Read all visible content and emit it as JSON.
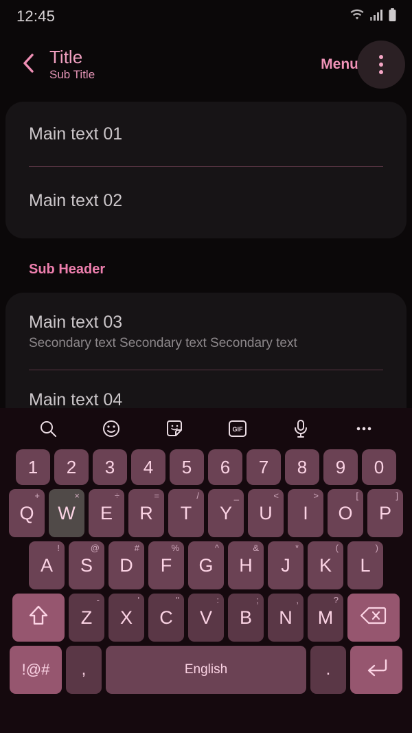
{
  "status_bar": {
    "time": "12:45",
    "icons": [
      "wifi-icon",
      "signal-icon",
      "battery-icon"
    ]
  },
  "app_bar": {
    "back_icon": "chevron-left-icon",
    "title": "Title",
    "subtitle": "Sub Title",
    "menu_label": "Menu",
    "overflow_icon": "more-vertical-icon"
  },
  "colors": {
    "accent_pink": "#f0a0c0",
    "subheader_pink": "#ee7fae",
    "card_bg": "#171416",
    "divider": "#5a3544",
    "key_bg": "#6b4254",
    "key_accent": "#96566f",
    "key_pressed": "#504a48",
    "keyboard_bg": "#15090e",
    "page_bg": "#0b0809"
  },
  "content": {
    "card_one": [
      {
        "main": "Main text 01",
        "secondary": ""
      },
      {
        "main": "Main text 02",
        "secondary": ""
      }
    ],
    "sub_header": "Sub Header",
    "card_two": [
      {
        "main": "Main text 03",
        "secondary": "Secondary text Secondary text Secondary text"
      },
      {
        "main": "Main text 04",
        "secondary": ""
      }
    ]
  },
  "keyboard": {
    "toolbar": [
      {
        "name": "search-icon",
        "label": ""
      },
      {
        "name": "emoji-icon",
        "label": ""
      },
      {
        "name": "sticker-icon",
        "label": ""
      },
      {
        "name": "gif-icon",
        "label": "GIF"
      },
      {
        "name": "microphone-icon",
        "label": ""
      },
      {
        "name": "more-horizontal-icon",
        "label": ""
      }
    ],
    "row_numbers": [
      {
        "key": "1",
        "alt": ""
      },
      {
        "key": "2",
        "alt": ""
      },
      {
        "key": "3",
        "alt": ""
      },
      {
        "key": "4",
        "alt": ""
      },
      {
        "key": "5",
        "alt": ""
      },
      {
        "key": "6",
        "alt": ""
      },
      {
        "key": "7",
        "alt": ""
      },
      {
        "key": "8",
        "alt": ""
      },
      {
        "key": "9",
        "alt": ""
      },
      {
        "key": "0",
        "alt": ""
      }
    ],
    "row_top": [
      {
        "key": "Q",
        "alt": "+",
        "pressed": false
      },
      {
        "key": "W",
        "alt": "×",
        "pressed": true
      },
      {
        "key": "E",
        "alt": "÷",
        "pressed": false
      },
      {
        "key": "R",
        "alt": "=",
        "pressed": false
      },
      {
        "key": "T",
        "alt": "/",
        "pressed": false
      },
      {
        "key": "Y",
        "alt": "_",
        "pressed": false
      },
      {
        "key": "U",
        "alt": "<",
        "pressed": false
      },
      {
        "key": "I",
        "alt": ">",
        "pressed": false
      },
      {
        "key": "O",
        "alt": "[",
        "pressed": false
      },
      {
        "key": "P",
        "alt": "]",
        "pressed": false
      }
    ],
    "row_home": [
      {
        "key": "A",
        "alt": "!"
      },
      {
        "key": "S",
        "alt": "@"
      },
      {
        "key": "D",
        "alt": "#"
      },
      {
        "key": "F",
        "alt": "%"
      },
      {
        "key": "G",
        "alt": "^"
      },
      {
        "key": "H",
        "alt": "&"
      },
      {
        "key": "J",
        "alt": "*"
      },
      {
        "key": "K",
        "alt": "("
      },
      {
        "key": "L",
        "alt": ")"
      }
    ],
    "row_bottom": [
      {
        "key": "Z",
        "alt": "-"
      },
      {
        "key": "X",
        "alt": "'"
      },
      {
        "key": "C",
        "alt": "\""
      },
      {
        "key": "V",
        "alt": ":"
      },
      {
        "key": "B",
        "alt": ";"
      },
      {
        "key": "N",
        "alt": ","
      },
      {
        "key": "M",
        "alt": "?"
      }
    ],
    "shift_icon": "shift-arrow-icon",
    "backspace_icon": "backspace-icon",
    "symbols_key": "!@#",
    "comma_key": ",",
    "space_key": "English",
    "period_key": ".",
    "enter_icon": "enter-return-icon"
  }
}
